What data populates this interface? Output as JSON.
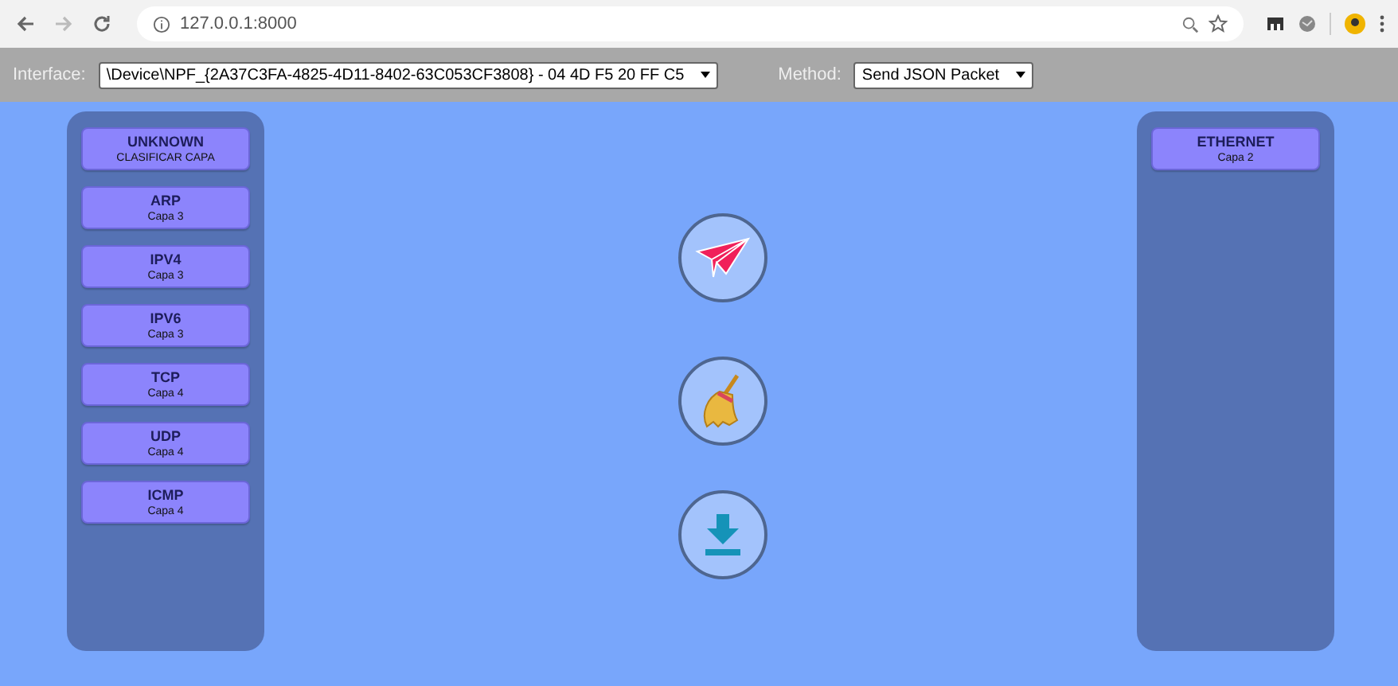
{
  "browser": {
    "url": "127.0.0.1:8000"
  },
  "toolbar": {
    "interface_label": "Interface:",
    "interface_value": "\\Device\\NPF_{2A37C3FA-4825-4D11-8402-63C053CF3808} - 04 4D F5 20 FF C5",
    "method_label": "Method:",
    "method_value": "Send JSON Packet"
  },
  "left_panel": [
    {
      "name": "UNKNOWN",
      "layer": "CLASIFICAR CAPA"
    },
    {
      "name": "ARP",
      "layer": "Capa 3"
    },
    {
      "name": "IPV4",
      "layer": "Capa 3"
    },
    {
      "name": "IPV6",
      "layer": "Capa 3"
    },
    {
      "name": "TCP",
      "layer": "Capa 4"
    },
    {
      "name": "UDP",
      "layer": "Capa 4"
    },
    {
      "name": "ICMP",
      "layer": "Capa 4"
    }
  ],
  "right_panel": [
    {
      "name": "ETHERNET",
      "layer": "Capa 2"
    }
  ],
  "actions": [
    {
      "kind": "send"
    },
    {
      "kind": "clear"
    },
    {
      "kind": "download"
    }
  ]
}
